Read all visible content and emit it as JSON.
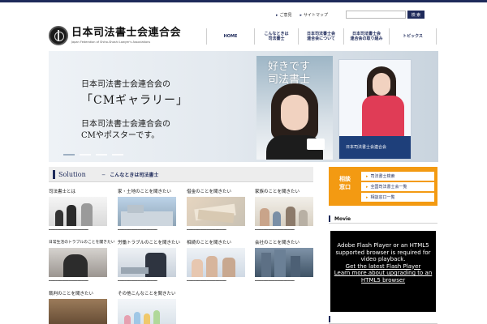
{
  "header": {
    "util_links": [
      "ご意見",
      "サイトマップ"
    ],
    "search": {
      "value": "",
      "placeholder": "",
      "button": "検 索"
    },
    "logo": {
      "title": "日本司法書士会連合会",
      "subtitle": "Japan Federation of Shiho-Shoshi Lawyer's Associations"
    }
  },
  "nav": {
    "items": [
      {
        "label": "HOME"
      },
      {
        "label": "こんなときは\n司法書士"
      },
      {
        "label": "日本司法書士会\n連合会について"
      },
      {
        "label": "日本司法書士会\n連合会の取り組み"
      },
      {
        "label": "トピックス"
      }
    ]
  },
  "hero": {
    "line1": "日本司法書士会連合会の",
    "line2": "「CMギャラリー」",
    "line3": "日本司法書士会連合会の",
    "line4": "CMやポスターです。",
    "poster_text": "好きです\n司法書士",
    "poster2_band": "日本司法書士会連合会",
    "active_slide": 1,
    "slides": 4
  },
  "solution": {
    "title": "Solution",
    "subtitle": "─　こんなときは司法書士",
    "items": [
      {
        "caption": "司法書士とは",
        "desc": "━━━━━━━━━━━━━━━━━━"
      },
      {
        "caption": "家・土地のことを聞きたい",
        "desc": "━━━━━━━━━━━━━━━━━━"
      },
      {
        "caption": "借金のことを聞きたい",
        "desc": "━━━━━━━━━━━━━━━━━━"
      },
      {
        "caption": "家族のことを聞きたい",
        "desc": "━━━━━━━━━━━━━━━━━━"
      },
      {
        "caption": "日常生活のトラブルのことを聞きたい",
        "desc": "━━━━━━━━━━━━━━━━━━"
      },
      {
        "caption": "労働トラブルのことを聞きたい",
        "desc": "━━━━━━━━━━━━━━━━━━"
      },
      {
        "caption": "相続のことを聞きたい",
        "desc": "━━━━━━━━━━━━━━━━━━"
      },
      {
        "caption": "会社のことを聞きたい",
        "desc": "━━━━━━━━━━━━━━━━━━"
      },
      {
        "caption": "裁判のことを聞きたい",
        "desc": ""
      },
      {
        "caption": "その他こんなことを聞きたい",
        "desc": ""
      }
    ]
  },
  "sidebar": {
    "consult_label": "相談\n窓口",
    "consult_links": [
      "司法書士検索",
      "全国司法書士会一覧",
      "相談窓口一覧"
    ],
    "movie_title": "Movie",
    "next_title": "",
    "flash": {
      "text": "Adobe Flash Player or an HTML5 supported browser is required for video playback.",
      "link1": "Get the latest Flash Player",
      "link2": "Learn more about upgrading to an HTML5 browser"
    }
  }
}
